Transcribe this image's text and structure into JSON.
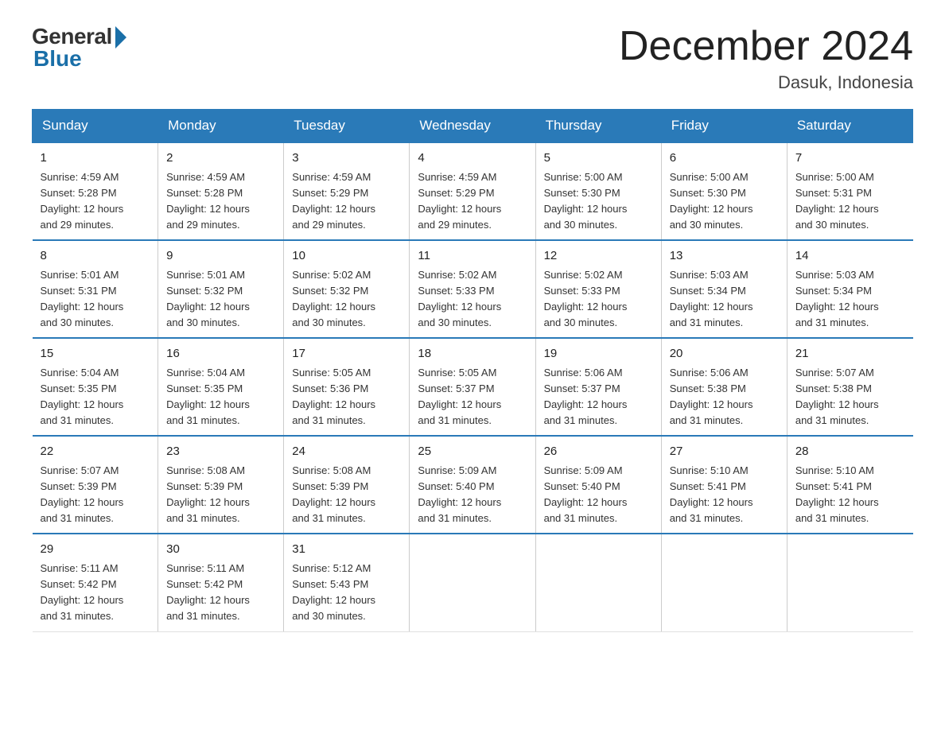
{
  "logo": {
    "general": "General",
    "blue": "Blue"
  },
  "title": "December 2024",
  "subtitle": "Dasuk, Indonesia",
  "days_header": [
    "Sunday",
    "Monday",
    "Tuesday",
    "Wednesday",
    "Thursday",
    "Friday",
    "Saturday"
  ],
  "weeks": [
    [
      {
        "day": "1",
        "sunrise": "4:59 AM",
        "sunset": "5:28 PM",
        "daylight": "12 hours and 29 minutes."
      },
      {
        "day": "2",
        "sunrise": "4:59 AM",
        "sunset": "5:28 PM",
        "daylight": "12 hours and 29 minutes."
      },
      {
        "day": "3",
        "sunrise": "4:59 AM",
        "sunset": "5:29 PM",
        "daylight": "12 hours and 29 minutes."
      },
      {
        "day": "4",
        "sunrise": "4:59 AM",
        "sunset": "5:29 PM",
        "daylight": "12 hours and 29 minutes."
      },
      {
        "day": "5",
        "sunrise": "5:00 AM",
        "sunset": "5:30 PM",
        "daylight": "12 hours and 30 minutes."
      },
      {
        "day": "6",
        "sunrise": "5:00 AM",
        "sunset": "5:30 PM",
        "daylight": "12 hours and 30 minutes."
      },
      {
        "day": "7",
        "sunrise": "5:00 AM",
        "sunset": "5:31 PM",
        "daylight": "12 hours and 30 minutes."
      }
    ],
    [
      {
        "day": "8",
        "sunrise": "5:01 AM",
        "sunset": "5:31 PM",
        "daylight": "12 hours and 30 minutes."
      },
      {
        "day": "9",
        "sunrise": "5:01 AM",
        "sunset": "5:32 PM",
        "daylight": "12 hours and 30 minutes."
      },
      {
        "day": "10",
        "sunrise": "5:02 AM",
        "sunset": "5:32 PM",
        "daylight": "12 hours and 30 minutes."
      },
      {
        "day": "11",
        "sunrise": "5:02 AM",
        "sunset": "5:33 PM",
        "daylight": "12 hours and 30 minutes."
      },
      {
        "day": "12",
        "sunrise": "5:02 AM",
        "sunset": "5:33 PM",
        "daylight": "12 hours and 30 minutes."
      },
      {
        "day": "13",
        "sunrise": "5:03 AM",
        "sunset": "5:34 PM",
        "daylight": "12 hours and 31 minutes."
      },
      {
        "day": "14",
        "sunrise": "5:03 AM",
        "sunset": "5:34 PM",
        "daylight": "12 hours and 31 minutes."
      }
    ],
    [
      {
        "day": "15",
        "sunrise": "5:04 AM",
        "sunset": "5:35 PM",
        "daylight": "12 hours and 31 minutes."
      },
      {
        "day": "16",
        "sunrise": "5:04 AM",
        "sunset": "5:35 PM",
        "daylight": "12 hours and 31 minutes."
      },
      {
        "day": "17",
        "sunrise": "5:05 AM",
        "sunset": "5:36 PM",
        "daylight": "12 hours and 31 minutes."
      },
      {
        "day": "18",
        "sunrise": "5:05 AM",
        "sunset": "5:37 PM",
        "daylight": "12 hours and 31 minutes."
      },
      {
        "day": "19",
        "sunrise": "5:06 AM",
        "sunset": "5:37 PM",
        "daylight": "12 hours and 31 minutes."
      },
      {
        "day": "20",
        "sunrise": "5:06 AM",
        "sunset": "5:38 PM",
        "daylight": "12 hours and 31 minutes."
      },
      {
        "day": "21",
        "sunrise": "5:07 AM",
        "sunset": "5:38 PM",
        "daylight": "12 hours and 31 minutes."
      }
    ],
    [
      {
        "day": "22",
        "sunrise": "5:07 AM",
        "sunset": "5:39 PM",
        "daylight": "12 hours and 31 minutes."
      },
      {
        "day": "23",
        "sunrise": "5:08 AM",
        "sunset": "5:39 PM",
        "daylight": "12 hours and 31 minutes."
      },
      {
        "day": "24",
        "sunrise": "5:08 AM",
        "sunset": "5:39 PM",
        "daylight": "12 hours and 31 minutes."
      },
      {
        "day": "25",
        "sunrise": "5:09 AM",
        "sunset": "5:40 PM",
        "daylight": "12 hours and 31 minutes."
      },
      {
        "day": "26",
        "sunrise": "5:09 AM",
        "sunset": "5:40 PM",
        "daylight": "12 hours and 31 minutes."
      },
      {
        "day": "27",
        "sunrise": "5:10 AM",
        "sunset": "5:41 PM",
        "daylight": "12 hours and 31 minutes."
      },
      {
        "day": "28",
        "sunrise": "5:10 AM",
        "sunset": "5:41 PM",
        "daylight": "12 hours and 31 minutes."
      }
    ],
    [
      {
        "day": "29",
        "sunrise": "5:11 AM",
        "sunset": "5:42 PM",
        "daylight": "12 hours and 31 minutes."
      },
      {
        "day": "30",
        "sunrise": "5:11 AM",
        "sunset": "5:42 PM",
        "daylight": "12 hours and 31 minutes."
      },
      {
        "day": "31",
        "sunrise": "5:12 AM",
        "sunset": "5:43 PM",
        "daylight": "12 hours and 30 minutes."
      },
      null,
      null,
      null,
      null
    ]
  ],
  "labels": {
    "sunrise": "Sunrise:",
    "sunset": "Sunset:",
    "daylight": "Daylight:"
  }
}
